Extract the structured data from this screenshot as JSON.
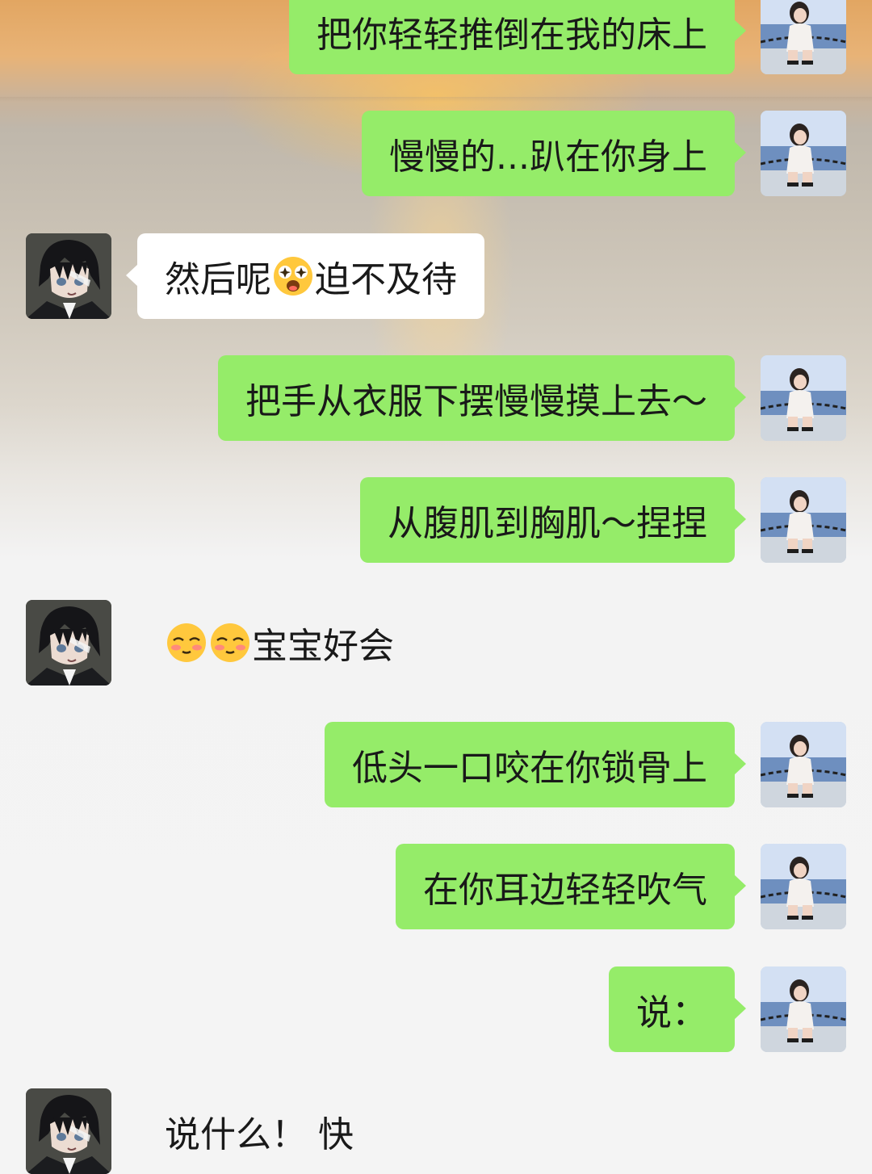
{
  "messages": [
    {
      "side": "me",
      "text": "把你轻轻推倒在我的床上",
      "avatar": "girl-photo-avatar"
    },
    {
      "side": "me",
      "text": "慢慢的...趴在你身上",
      "avatar": "girl-photo-avatar"
    },
    {
      "side": "other",
      "text_before": "然后呢",
      "emoji": "starry-eyed-emoji",
      "text_after": "迫不及待",
      "avatar": "anime-boy-avatar"
    },
    {
      "side": "me",
      "text": "把手从衣服下摆慢慢摸上去～",
      "avatar": "girl-photo-avatar"
    },
    {
      "side": "me",
      "text": "从腹肌到胸肌～捏捏",
      "avatar": "girl-photo-avatar"
    },
    {
      "side": "other",
      "emojis": [
        "shy-blush-emoji",
        "shy-blush-emoji"
      ],
      "text": "宝宝好会",
      "avatar": "anime-boy-avatar"
    },
    {
      "side": "me",
      "text": "低头一口咬在你锁骨上",
      "avatar": "girl-photo-avatar"
    },
    {
      "side": "me",
      "text": "在你耳边轻轻吹气",
      "avatar": "girl-photo-avatar"
    },
    {
      "side": "me",
      "text": "说：",
      "avatar": "girl-photo-avatar"
    },
    {
      "side": "other",
      "text": "说什么！ 快",
      "avatar": "anime-boy-avatar"
    }
  ],
  "colors": {
    "my_bubble": "#95ec69",
    "their_bubble": "#ffffff",
    "text": "#191919",
    "sunset": "#e8b377",
    "sea": "#c9c1b4"
  }
}
